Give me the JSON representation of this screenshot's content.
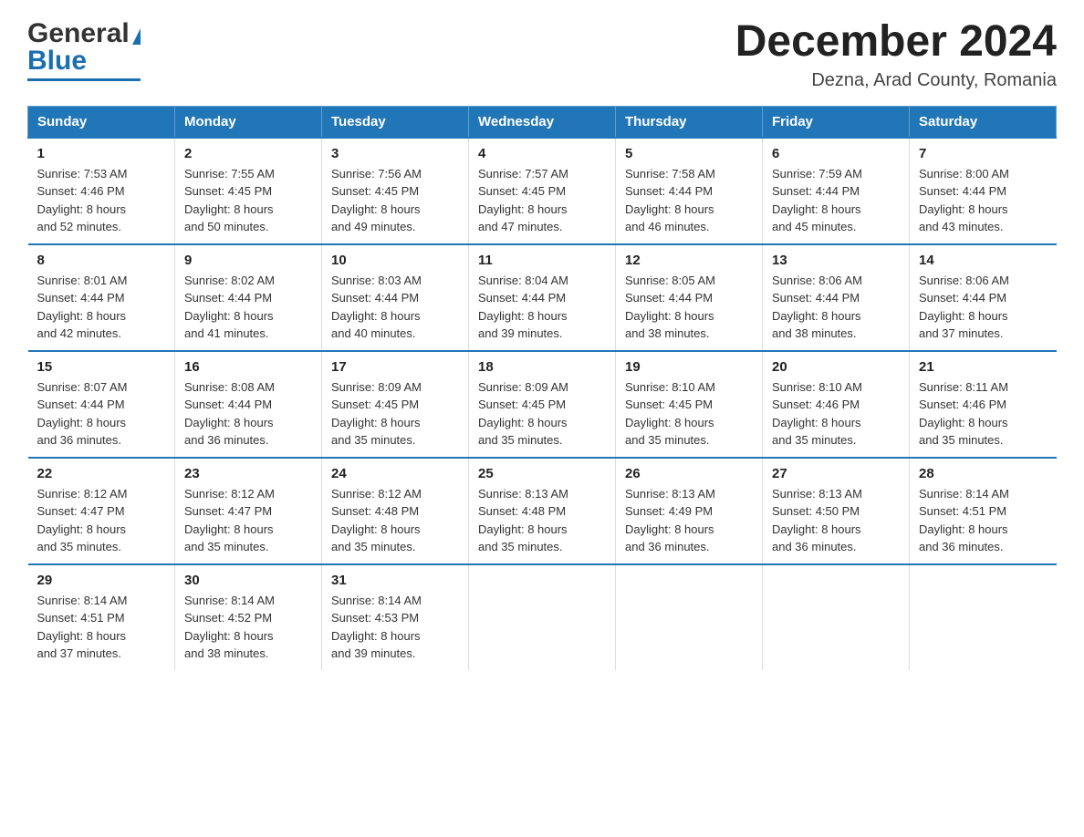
{
  "logo": {
    "general": "General",
    "triangle": "▶",
    "blue": "Blue"
  },
  "header": {
    "month_title": "December 2024",
    "location": "Dezna, Arad County, Romania"
  },
  "days_of_week": [
    "Sunday",
    "Monday",
    "Tuesday",
    "Wednesday",
    "Thursday",
    "Friday",
    "Saturday"
  ],
  "weeks": [
    [
      {
        "day": "1",
        "sunrise": "7:53 AM",
        "sunset": "4:46 PM",
        "daylight": "8 hours and 52 minutes."
      },
      {
        "day": "2",
        "sunrise": "7:55 AM",
        "sunset": "4:45 PM",
        "daylight": "8 hours and 50 minutes."
      },
      {
        "day": "3",
        "sunrise": "7:56 AM",
        "sunset": "4:45 PM",
        "daylight": "8 hours and 49 minutes."
      },
      {
        "day": "4",
        "sunrise": "7:57 AM",
        "sunset": "4:45 PM",
        "daylight": "8 hours and 47 minutes."
      },
      {
        "day": "5",
        "sunrise": "7:58 AM",
        "sunset": "4:44 PM",
        "daylight": "8 hours and 46 minutes."
      },
      {
        "day": "6",
        "sunrise": "7:59 AM",
        "sunset": "4:44 PM",
        "daylight": "8 hours and 45 minutes."
      },
      {
        "day": "7",
        "sunrise": "8:00 AM",
        "sunset": "4:44 PM",
        "daylight": "8 hours and 43 minutes."
      }
    ],
    [
      {
        "day": "8",
        "sunrise": "8:01 AM",
        "sunset": "4:44 PM",
        "daylight": "8 hours and 42 minutes."
      },
      {
        "day": "9",
        "sunrise": "8:02 AM",
        "sunset": "4:44 PM",
        "daylight": "8 hours and 41 minutes."
      },
      {
        "day": "10",
        "sunrise": "8:03 AM",
        "sunset": "4:44 PM",
        "daylight": "8 hours and 40 minutes."
      },
      {
        "day": "11",
        "sunrise": "8:04 AM",
        "sunset": "4:44 PM",
        "daylight": "8 hours and 39 minutes."
      },
      {
        "day": "12",
        "sunrise": "8:05 AM",
        "sunset": "4:44 PM",
        "daylight": "8 hours and 38 minutes."
      },
      {
        "day": "13",
        "sunrise": "8:06 AM",
        "sunset": "4:44 PM",
        "daylight": "8 hours and 38 minutes."
      },
      {
        "day": "14",
        "sunrise": "8:06 AM",
        "sunset": "4:44 PM",
        "daylight": "8 hours and 37 minutes."
      }
    ],
    [
      {
        "day": "15",
        "sunrise": "8:07 AM",
        "sunset": "4:44 PM",
        "daylight": "8 hours and 36 minutes."
      },
      {
        "day": "16",
        "sunrise": "8:08 AM",
        "sunset": "4:44 PM",
        "daylight": "8 hours and 36 minutes."
      },
      {
        "day": "17",
        "sunrise": "8:09 AM",
        "sunset": "4:45 PM",
        "daylight": "8 hours and 35 minutes."
      },
      {
        "day": "18",
        "sunrise": "8:09 AM",
        "sunset": "4:45 PM",
        "daylight": "8 hours and 35 minutes."
      },
      {
        "day": "19",
        "sunrise": "8:10 AM",
        "sunset": "4:45 PM",
        "daylight": "8 hours and 35 minutes."
      },
      {
        "day": "20",
        "sunrise": "8:10 AM",
        "sunset": "4:46 PM",
        "daylight": "8 hours and 35 minutes."
      },
      {
        "day": "21",
        "sunrise": "8:11 AM",
        "sunset": "4:46 PM",
        "daylight": "8 hours and 35 minutes."
      }
    ],
    [
      {
        "day": "22",
        "sunrise": "8:12 AM",
        "sunset": "4:47 PM",
        "daylight": "8 hours and 35 minutes."
      },
      {
        "day": "23",
        "sunrise": "8:12 AM",
        "sunset": "4:47 PM",
        "daylight": "8 hours and 35 minutes."
      },
      {
        "day": "24",
        "sunrise": "8:12 AM",
        "sunset": "4:48 PM",
        "daylight": "8 hours and 35 minutes."
      },
      {
        "day": "25",
        "sunrise": "8:13 AM",
        "sunset": "4:48 PM",
        "daylight": "8 hours and 35 minutes."
      },
      {
        "day": "26",
        "sunrise": "8:13 AM",
        "sunset": "4:49 PM",
        "daylight": "8 hours and 36 minutes."
      },
      {
        "day": "27",
        "sunrise": "8:13 AM",
        "sunset": "4:50 PM",
        "daylight": "8 hours and 36 minutes."
      },
      {
        "day": "28",
        "sunrise": "8:14 AM",
        "sunset": "4:51 PM",
        "daylight": "8 hours and 36 minutes."
      }
    ],
    [
      {
        "day": "29",
        "sunrise": "8:14 AM",
        "sunset": "4:51 PM",
        "daylight": "8 hours and 37 minutes."
      },
      {
        "day": "30",
        "sunrise": "8:14 AM",
        "sunset": "4:52 PM",
        "daylight": "8 hours and 38 minutes."
      },
      {
        "day": "31",
        "sunrise": "8:14 AM",
        "sunset": "4:53 PM",
        "daylight": "8 hours and 39 minutes."
      },
      null,
      null,
      null,
      null
    ]
  ],
  "labels": {
    "sunrise": "Sunrise:",
    "sunset": "Sunset:",
    "daylight": "Daylight:"
  }
}
